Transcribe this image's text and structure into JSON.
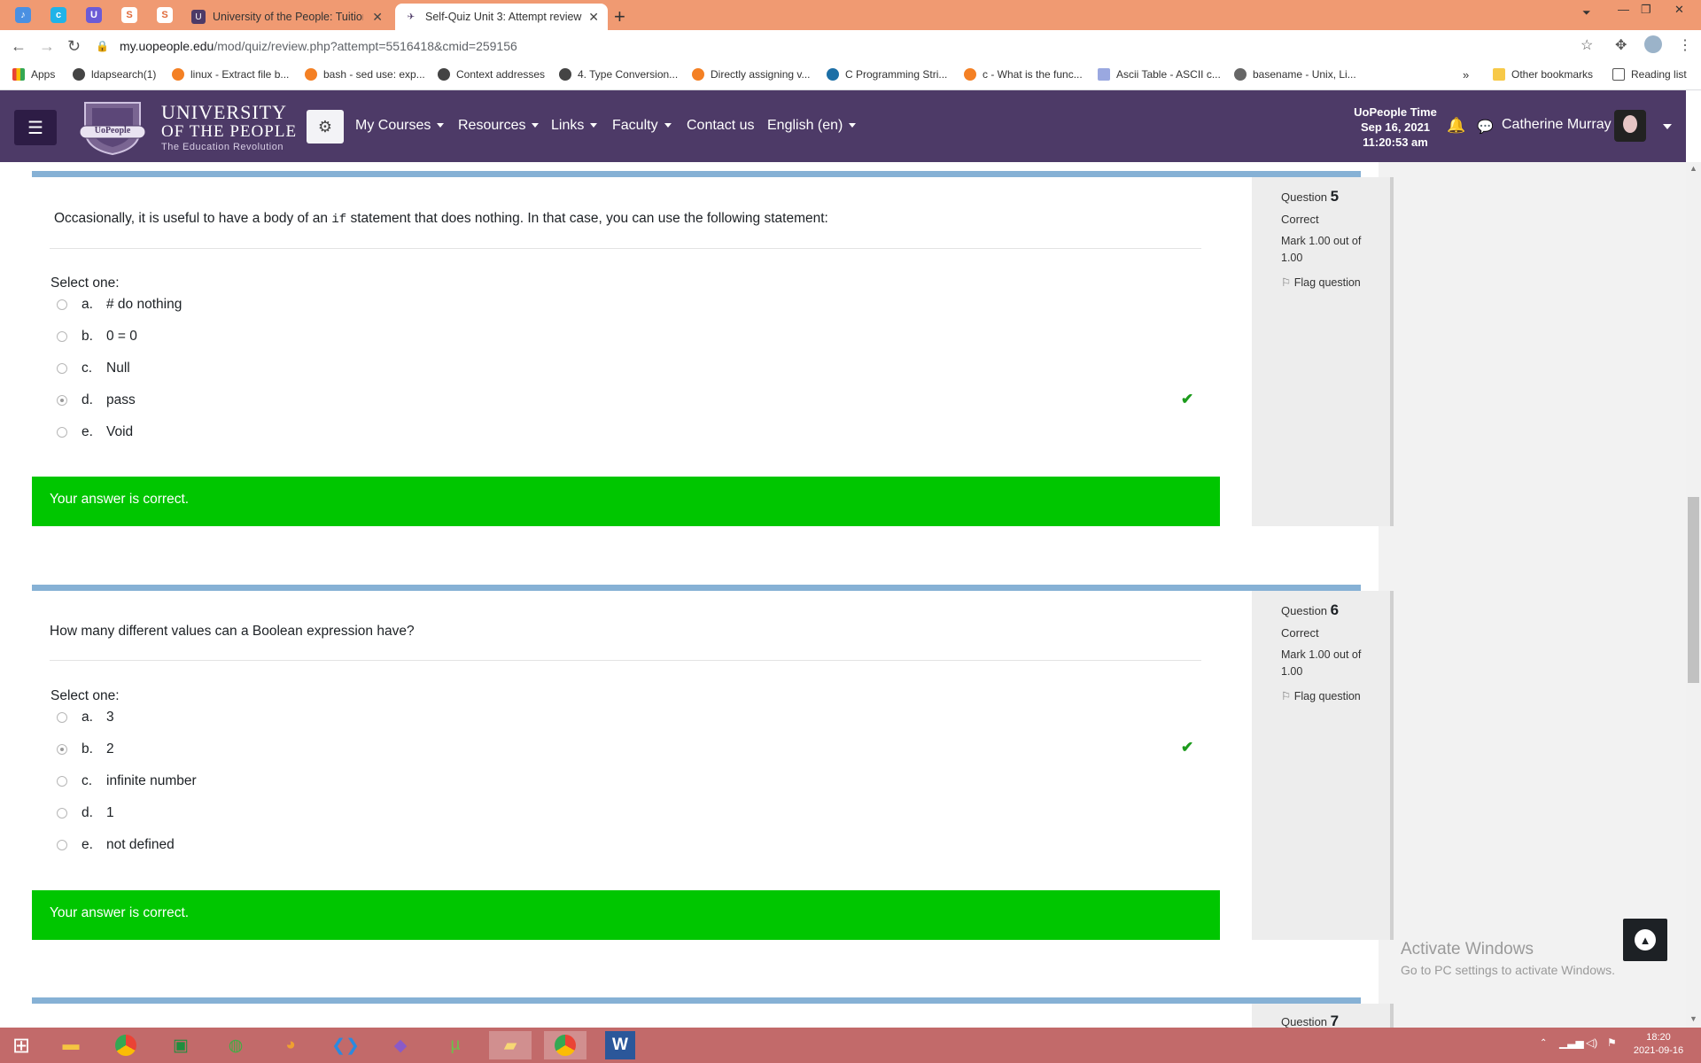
{
  "browser": {
    "tabs": [
      {
        "title": "University of the People: Tuition-",
        "active": false
      },
      {
        "title": "Self-Quiz Unit 3: Attempt review",
        "active": true
      }
    ],
    "url": {
      "host": "my.uopeople.edu",
      "path": "/mod/quiz/review.php?attempt=5516418&cmid=259156"
    },
    "bookmarks": [
      "Apps",
      "ldapsearch(1)",
      "linux - Extract file b...",
      "bash - sed use: exp...",
      "Context addresses",
      "4. Type Conversion...",
      "Directly assigning v...",
      "C Programming Stri...",
      "c - What is the func...",
      "Ascii Table - ASCII c...",
      "basename - Unix, Li..."
    ],
    "bookmarks_more": "»",
    "other_bookmarks": "Other bookmarks",
    "reading_list": "Reading list"
  },
  "site": {
    "logo": {
      "line1": "UNIVERSITY",
      "line2": "OF THE PEOPLE",
      "tagline": "The Education Revolution",
      "badge": "UoPeople"
    },
    "menu": [
      {
        "label": "My Courses",
        "dropdown": true
      },
      {
        "label": "Resources",
        "dropdown": true
      },
      {
        "label": "Links",
        "dropdown": true
      },
      {
        "label": "Faculty",
        "dropdown": true
      },
      {
        "label": "Contact us",
        "dropdown": false
      },
      {
        "label": "English (en)",
        "dropdown": true
      }
    ],
    "time": {
      "label": "UoPeople Time",
      "date": "Sep 16, 2021",
      "clock": "11:20:53 am"
    },
    "user": "Catherine Murray"
  },
  "questions": [
    {
      "label": "Question",
      "number": "5",
      "state": "Correct",
      "mark": "Mark 1.00 out of 1.00",
      "flag": "Flag question",
      "text_before": "Occasionally, it is useful to have a body of an ",
      "text_code": "if",
      "text_after": " statement that does nothing. In that case, you can use the following statement:",
      "select": "Select one:",
      "options": [
        {
          "letter": "a.",
          "text": "# do nothing",
          "selected": false
        },
        {
          "letter": "b.",
          "text": "0 = 0",
          "selected": false
        },
        {
          "letter": "c.",
          "text": "Null",
          "selected": false
        },
        {
          "letter": "d.",
          "text": "pass",
          "selected": true
        },
        {
          "letter": "e.",
          "text": "Void",
          "selected": false
        }
      ],
      "feedback": "Your answer is correct."
    },
    {
      "label": "Question",
      "number": "6",
      "state": "Correct",
      "mark": "Mark 1.00 out of 1.00",
      "flag": "Flag question",
      "text": "How many different values can a Boolean expression have?",
      "select": "Select one:",
      "options": [
        {
          "letter": "a.",
          "text": "3",
          "selected": false
        },
        {
          "letter": "b.",
          "text": "2",
          "selected": true
        },
        {
          "letter": "c.",
          "text": "infinite number",
          "selected": false
        },
        {
          "letter": "d.",
          "text": "1",
          "selected": false
        },
        {
          "letter": "e.",
          "text": "not defined",
          "selected": false
        }
      ],
      "feedback": "Your answer is correct."
    },
    {
      "label": "Question",
      "number": "7"
    }
  ],
  "watermark": {
    "title": "Activate Windows",
    "subtitle": "Go to PC settings to activate Windows."
  },
  "taskbar": {
    "time": "18:20",
    "date": "2021-09-16"
  },
  "colors": {
    "navbar": "#4d3a67",
    "correct": "#00c600",
    "card_top": "#86b1d5",
    "tabbar": "#f09a72",
    "taskbar": "#c26a6a"
  }
}
